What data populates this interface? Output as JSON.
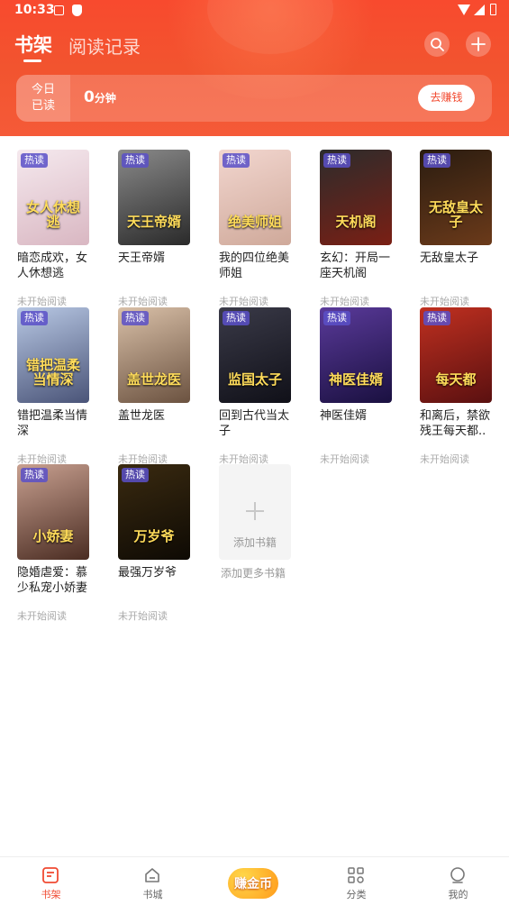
{
  "status_bar": {
    "time": "10:33"
  },
  "header": {
    "tab_shelf": "书架",
    "tab_history": "阅读记录",
    "today_label_1": "今日",
    "today_label_2": "已读",
    "minutes_value": "0",
    "minutes_unit": "分钟",
    "earn_button": "去赚钱"
  },
  "books": [
    {
      "title": "暗恋成欢，女人休想逃",
      "status": "未开始阅读",
      "badge": "热读",
      "cover_text": "女人休想逃",
      "colors": [
        "#f5e9ee",
        "#d9b7c2"
      ]
    },
    {
      "title": "天王帝婿",
      "status": "未开始阅读",
      "badge": "热读",
      "cover_text": "天王帝婿",
      "colors": [
        "#8a8a8a",
        "#2a2a2a"
      ]
    },
    {
      "title": "我的四位绝美师姐",
      "status": "未开始阅读",
      "badge": "热读",
      "cover_text": "绝美师姐",
      "colors": [
        "#f2d6cf",
        "#cfa99a"
      ]
    },
    {
      "title": "玄幻：开局一座天机阁",
      "status": "未开始阅读",
      "badge": "热读",
      "cover_text": "天机阁",
      "colors": [
        "#2c2c2c",
        "#7a1f14"
      ]
    },
    {
      "title": "无敌皇太子",
      "status": "未开始阅读",
      "badge": "热读",
      "cover_text": "无敌皇太子",
      "colors": [
        "#2a1c10",
        "#6b3a1a"
      ]
    },
    {
      "title": "错把温柔当情深",
      "status": "未开始阅读",
      "badge": "热读",
      "cover_text": "错把温柔当情深",
      "colors": [
        "#b8c8e4",
        "#4a5478"
      ]
    },
    {
      "title": "盖世龙医",
      "status": "未开始阅读",
      "badge": "热读",
      "cover_text": "盖世龙医",
      "colors": [
        "#d9c0a8",
        "#6b5240"
      ]
    },
    {
      "title": "回到古代当太子",
      "status": "未开始阅读",
      "badge": "热读",
      "cover_text": "监国太子",
      "colors": [
        "#3a3a48",
        "#101018"
      ]
    },
    {
      "title": "神医佳婿",
      "status": "未开始阅读",
      "badge": "热读",
      "cover_text": "神医佳婿",
      "colors": [
        "#5a3a9a",
        "#1a1040"
      ]
    },
    {
      "title": "和离后，禁欲残王每天都..",
      "status": "未开始阅读",
      "badge": "热读",
      "cover_text": "每天都",
      "colors": [
        "#c03020",
        "#5a1010"
      ]
    },
    {
      "title": "隐婚虐爱：慕少私宠小娇妻",
      "status": "未开始阅读",
      "badge": "热读",
      "cover_text": "小娇妻",
      "colors": [
        "#c8a090",
        "#4a2c22"
      ]
    },
    {
      "title": "最强万岁爷",
      "status": "未开始阅读",
      "badge": "热读",
      "cover_text": "万岁爷",
      "colors": [
        "#3a2a10",
        "#0e0a04"
      ]
    }
  ],
  "add_book": {
    "label": "添加书籍",
    "more": "添加更多书籍"
  },
  "nav": {
    "shelf": "书架",
    "store": "书城",
    "earn": "赚金币",
    "category": "分类",
    "mine": "我的"
  },
  "colors": {
    "accent": "#f04a32",
    "header": "#f84a2e"
  }
}
